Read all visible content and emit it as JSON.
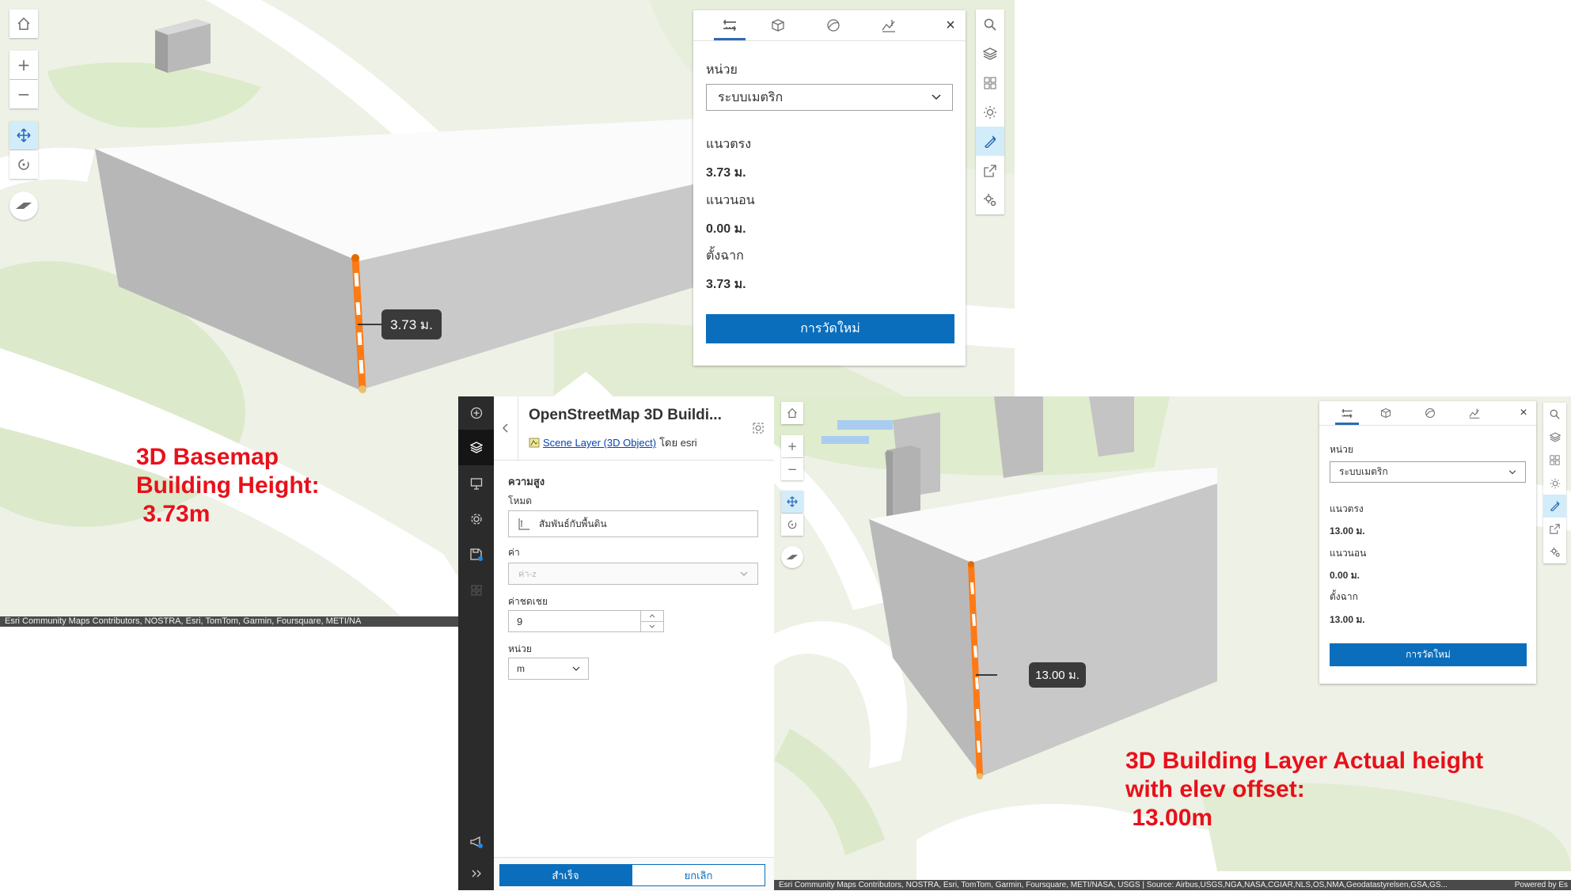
{
  "top_scene": {
    "callout": "3.73 ม.",
    "attribution": "Esri Community Maps Contributors, NOSTRA, Esri, TomTom, Garmin, Foursquare, METI/NA",
    "map_controls": {
      "home_icon": "home-icon",
      "zoom_in": "+",
      "zoom_out": "−"
    },
    "measure_panel": {
      "unit_label": "หน่วย",
      "unit_value": "ระบบเมตริก",
      "vertical_label": "แนวตรง",
      "vertical_value": "3.73 ม.",
      "horizontal_label": "แนวนอน",
      "horizontal_value": "0.00 ม.",
      "direct_label": "ตั้งฉาก",
      "direct_value": "3.73 ม.",
      "new_button": "การวัดใหม่",
      "close": "×"
    }
  },
  "note_basemap": "3D Basemap\nBuilding Height:\n 3.73m",
  "layer_panel": {
    "title": "OpenStreetMap 3D Buildi...",
    "type_link": "Scene Layer (3D Object)",
    "by_text": "โดย esri",
    "section": "ความสูง",
    "mode_label": "โหมด",
    "mode_value": "สัมพันธ์กับพื้นดิน",
    "value_label": "ค่า",
    "value_placeholder": "ค่า-z",
    "offset_label": "ค่าชดเชย",
    "offset_value": "9",
    "unit_label": "หน่วย",
    "unit_value": "m",
    "done_button": "สำเร็จ",
    "cancel_button": "ยกเลิก"
  },
  "bottom_scene": {
    "callout": "13.00 ม.",
    "attribution": "Esri Community Maps Contributors, NOSTRA, Esri, TomTom, Garmin, Foursquare, METI/NASA, USGS | Source: Airbus,USGS,NGA,NASA,CGIAR,NLS,OS,NMA,Geodatastyrelsen,GSA,GS...",
    "powered": "Powered by Es",
    "measure_panel": {
      "unit_label": "หน่วย",
      "unit_value": "ระบบเมตริก",
      "vertical_label": "แนวตรง",
      "vertical_value": "13.00 ม.",
      "horizontal_label": "แนวนอน",
      "horizontal_value": "0.00 ม.",
      "direct_label": "ตั้งฉาก",
      "direct_value": "13.00 ม.",
      "new_button": "การวัดใหม่",
      "close": "×"
    }
  },
  "note_layer": "3D Building Layer Actual height\nwith elev offset:\n 13.00m",
  "colors": {
    "accent": "#0a6ebd",
    "annotation": "#e8101a",
    "map_bg": "#eef1e6",
    "building": "#c9c9c9"
  }
}
